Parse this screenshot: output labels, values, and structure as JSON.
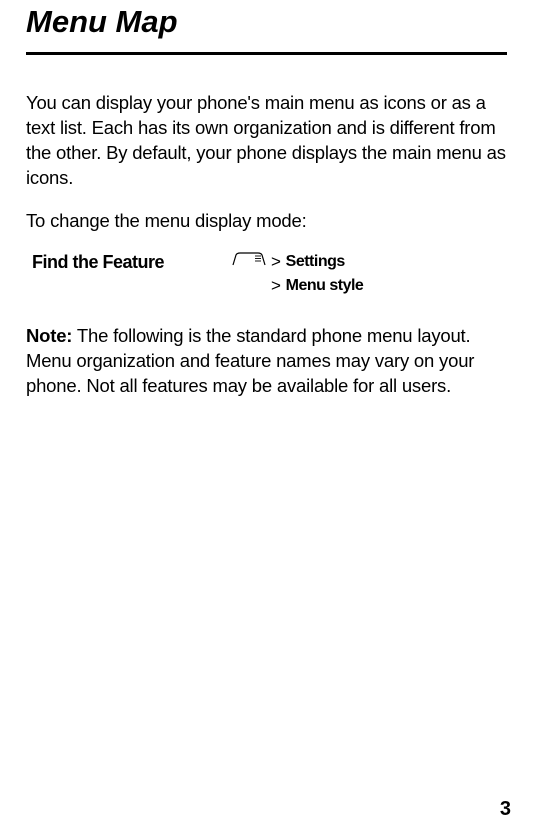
{
  "title": "Menu Map",
  "intro": "You can display your phone's main menu as icons or as a text list. Each has its own organization and is different from the other. By default, your phone displays the main menu as icons.",
  "change_mode": "To change the menu display mode:",
  "feature": {
    "label": "Find the Feature",
    "gt": ">",
    "item1": "Settings",
    "item2": "Menu style"
  },
  "note": {
    "label": "Note:",
    "text": " The following is the standard phone menu layout. Menu organization and feature names may vary on your phone. Not all features may be available for all users."
  },
  "page_number": "3"
}
